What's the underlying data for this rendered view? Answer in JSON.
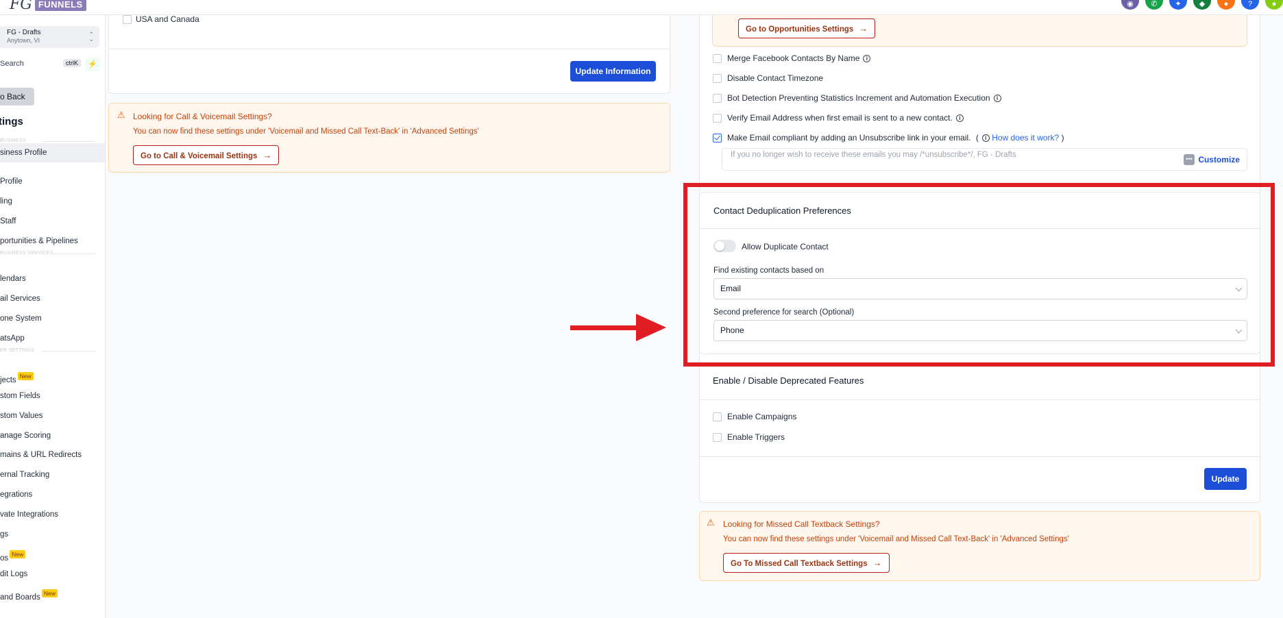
{
  "topbar": {
    "logo_prefix": "FG",
    "logo_brand": "FUNNELS",
    "icons": [
      {
        "name": "chat-icon",
        "color": "#6b5fa8",
        "glyph": "◉"
      },
      {
        "name": "phone-icon",
        "color": "#16a34a",
        "glyph": "✆"
      },
      {
        "name": "sparkle-icon",
        "color": "#2563eb",
        "glyph": "✦"
      },
      {
        "name": "megaphone-icon",
        "color": "#15803d",
        "glyph": "◆"
      },
      {
        "name": "bell-icon",
        "color": "#f97316",
        "glyph": "●"
      },
      {
        "name": "help-icon",
        "color": "#2563eb",
        "glyph": "?"
      },
      {
        "name": "avatar-icon",
        "color": "#84cc16",
        "glyph": "●"
      }
    ]
  },
  "sidebar": {
    "location_name": "FG - Drafts",
    "location_address": "Anytown, VI",
    "search_label": "Search",
    "search_shortcut": "ctrlK",
    "back_label": "o Back",
    "title": "tings",
    "sections": [
      "BUSINESS",
      "BUSINESS SERVICES",
      "ER SETTINGS"
    ],
    "items": [
      {
        "label": "siness Profile",
        "active": true
      },
      {
        "label": "Profile"
      },
      {
        "label": "ling"
      },
      {
        "label": "Staff"
      },
      {
        "label": "portunities & Pipelines"
      },
      {
        "label": "lendars"
      },
      {
        "label": "ail Services"
      },
      {
        "label": "one System"
      },
      {
        "label": "atsApp"
      },
      {
        "label": "jects",
        "badge": "New"
      },
      {
        "label": "stom Fields"
      },
      {
        "label": "stom Values"
      },
      {
        "label": "anage Scoring"
      },
      {
        "label": "mains & URL Redirects"
      },
      {
        "label": "ernal Tracking"
      },
      {
        "label": "egrations"
      },
      {
        "label": "vate Integrations"
      },
      {
        "label": "gs"
      },
      {
        "label": "os",
        "badge": "New"
      },
      {
        "label": "dit Logs"
      },
      {
        "label": "and Boards",
        "badge": "New"
      }
    ]
  },
  "left": {
    "usa_label": "USA and Canada",
    "update_button": "Update Information",
    "call_notice": {
      "title": "Looking for Call & Voicemail Settings?",
      "body": "You can now find these settings under 'Voicemail and Missed Call Text-Back' in 'Advanced Settings'",
      "button": "Go to Call & Voicemail Settings"
    }
  },
  "right": {
    "opp_button": "Go to Opportunities Settings",
    "options": [
      {
        "label": "Merge Facebook Contacts By Name",
        "checked": false,
        "info": true
      },
      {
        "label": "Disable Contact Timezone",
        "checked": false,
        "info": false
      },
      {
        "label": "Bot Detection Preventing Statistics Increment and Automation Execution",
        "checked": false,
        "info": true
      },
      {
        "label": "Verify Email Address when first email is sent to a new contact.",
        "checked": false,
        "info": true
      },
      {
        "label": "Make Email compliant by adding an Unsubscribe link in your email.",
        "checked": true,
        "info": true
      }
    ],
    "how_link_open": "(",
    "how_link": "How does it work?",
    "how_link_close": ")",
    "unsub_placeholder": "If you no longer wish to receive these emails you may /*unsubscribe*/, FG - Drafts",
    "customize": "Customize",
    "dedup": {
      "title": "Contact Deduplication Preferences",
      "toggle_label": "Allow Duplicate Contact",
      "toggle_on": false,
      "find_label": "Find existing contacts based on",
      "find_value": "Email",
      "second_label": "Second preference for search (Optional)",
      "second_value": "Phone"
    },
    "deprecated": {
      "title": "Enable / Disable Deprecated Features",
      "campaigns": "Enable Campaigns",
      "triggers": "Enable Triggers",
      "update": "Update"
    },
    "missed_notice": {
      "title": "Looking for Missed Call Textback Settings?",
      "body": "You can now find these settings under 'Voicemail and Missed Call Text-Back' in 'Advanced Settings'",
      "button": "Go To Missed Call Textback Settings"
    }
  },
  "colors": {
    "primary": "#1d4ed8",
    "highlight": "#e11d24",
    "notice_bg": "#fff7ed",
    "notice_text": "#c2410c"
  }
}
